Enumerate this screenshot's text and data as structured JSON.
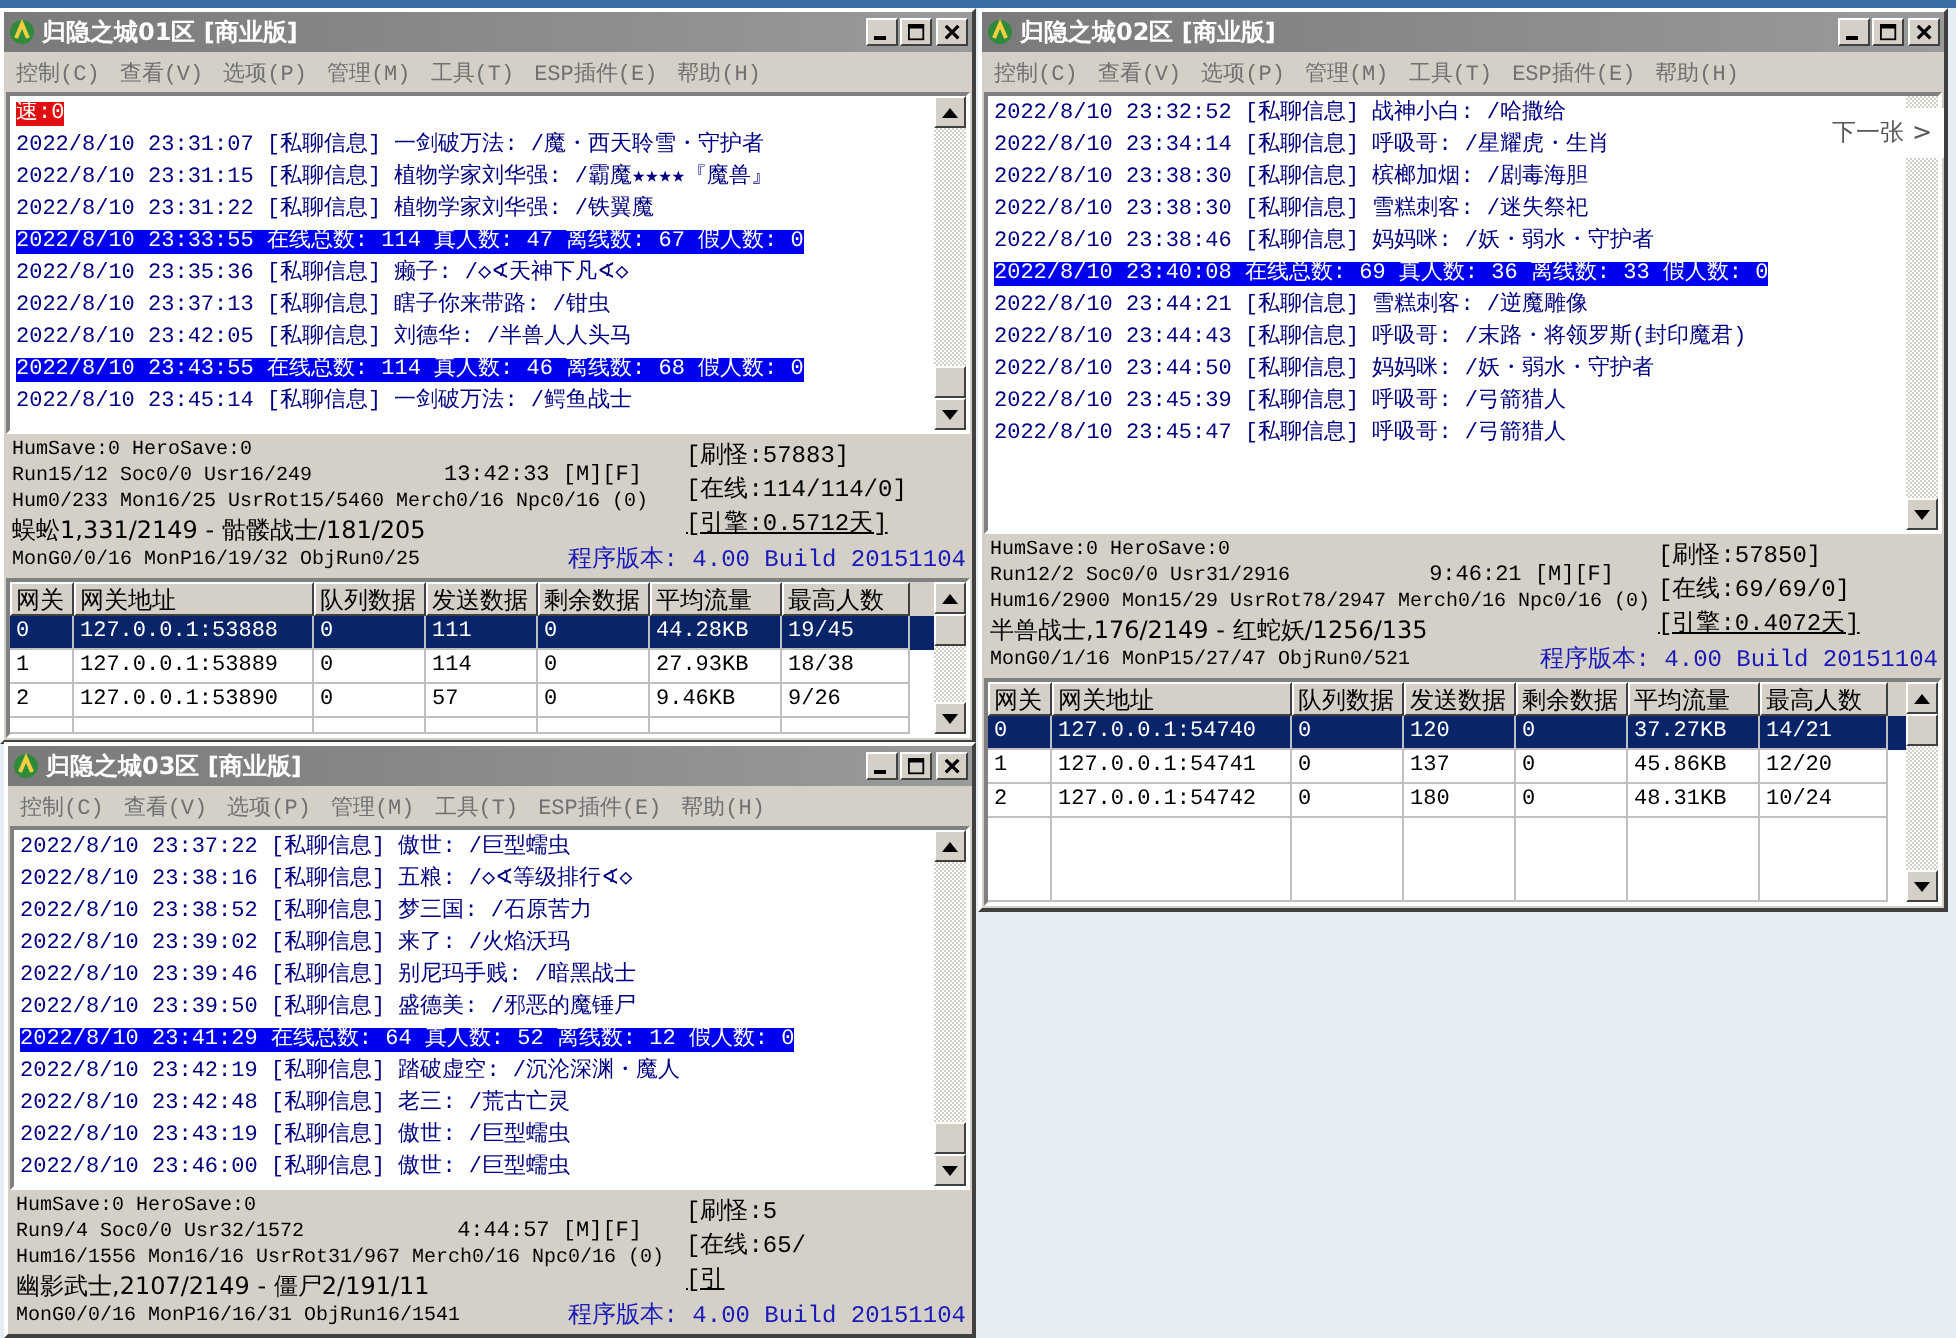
{
  "windows": [
    {
      "title": "归隐之城01区 [商业版]",
      "menu": [
        "控制(C)",
        "查看(V)",
        "选项(P)",
        "管理(M)",
        "工具(T)",
        "ESP插件(E)",
        "帮助(H)"
      ],
      "log": [
        {
          "kind": "alert",
          "text": "速:0"
        },
        {
          "kind": "chat",
          "text": "2022/8/10 23:31:07 [私聊信息] 一剑破万法: /魔・西天聆雪・守护者"
        },
        {
          "kind": "chat",
          "text": "2022/8/10 23:31:15 [私聊信息] 植物学家刘华强: /霸魔★★★★『魔兽』"
        },
        {
          "kind": "chat",
          "text": "2022/8/10 23:31:22 [私聊信息] 植物学家刘华强: /铁翼魔"
        },
        {
          "kind": "stat",
          "text": "2022/8/10 23:33:55 在线总数: 114 真人数: 47 离线数: 67 假人数: 0"
        },
        {
          "kind": "chat",
          "text": "2022/8/10 23:35:36 [私聊信息] 癞子: /◇∢天神下凡∢◇"
        },
        {
          "kind": "chat",
          "text": "2022/8/10 23:37:13 [私聊信息] 瞎子你来带路: /钳虫"
        },
        {
          "kind": "chat",
          "text": "2022/8/10 23:42:05 [私聊信息] 刘德华: /半兽人人头马"
        },
        {
          "kind": "stat",
          "text": "2022/8/10 23:43:55 在线总数: 114 真人数: 46 离线数: 68 假人数: 0"
        },
        {
          "kind": "chat",
          "text": "2022/8/10 23:45:14 [私聊信息] 一剑破万法: /鳄鱼战士"
        }
      ],
      "status": {
        "save": "HumSave:0 HeroSave:0",
        "run": "Run15/12 Soc0/0 Usr16/249",
        "time": "13:42:33 [M][F]",
        "hum": "Hum0/233 Mon16/25 UsrRot15/5460 Merch0/16 Npc0/16 (0)",
        "mon": "蜈蚣1,331/2149 - 骷髅战士/181/205",
        "mong": "MonG0/0/16 MonP16/19/32 ObjRun0/25",
        "refresh": "[刷怪:57883]",
        "online": "[在线:114/114/0]",
        "engine": "[引擎:0.5712天]",
        "version": "程序版本: 4.00 Build 20151104"
      },
      "table": {
        "columns": [
          "网关",
          "网关地址",
          "队列数据",
          "发送数据",
          "剩余数据",
          "平均流量",
          "最高人数"
        ],
        "rows": [
          {
            "cells": [
              "0",
              "127.0.0.1:53888",
              "0",
              "111",
              "0",
              "44.28KB",
              "19/45"
            ],
            "selected": true
          },
          {
            "cells": [
              "1",
              "127.0.0.1:53889",
              "0",
              "114",
              "0",
              "27.93KB",
              "18/38"
            ],
            "selected": false
          },
          {
            "cells": [
              "2",
              "127.0.0.1:53890",
              "0",
              "57",
              "0",
              "9.46KB",
              "9/26"
            ],
            "selected": false
          }
        ]
      }
    },
    {
      "title": "归隐之城02区 [商业版]",
      "menu": [
        "控制(C)",
        "查看(V)",
        "选项(P)",
        "管理(M)",
        "工具(T)",
        "ESP插件(E)",
        "帮助(H)"
      ],
      "log": [
        {
          "kind": "chat",
          "text": "2022/8/10 23:32:52 [私聊信息] 战神小白: /哈撒给"
        },
        {
          "kind": "chat",
          "text": "2022/8/10 23:34:14 [私聊信息] 呼吸哥: /星耀虎・生肖"
        },
        {
          "kind": "chat",
          "text": "2022/8/10 23:38:30 [私聊信息] 槟榔加烟: /剧毒海胆"
        },
        {
          "kind": "chat",
          "text": "2022/8/10 23:38:30 [私聊信息] 雪糕刺客: /迷失祭祀"
        },
        {
          "kind": "chat",
          "text": "2022/8/10 23:38:46 [私聊信息] 妈妈咪: /妖・弱水・守护者"
        },
        {
          "kind": "stat",
          "text": "2022/8/10 23:40:08 在线总数: 69 真人数: 36 离线数: 33 假人数: 0"
        },
        {
          "kind": "chat",
          "text": "2022/8/10 23:44:21 [私聊信息] 雪糕刺客: /逆魔雕像"
        },
        {
          "kind": "chat",
          "text": "2022/8/10 23:44:43 [私聊信息] 呼吸哥: /末路・将领罗斯(封印魔君)"
        },
        {
          "kind": "chat",
          "text": "2022/8/10 23:44:50 [私聊信息] 妈妈咪: /妖・弱水・守护者"
        },
        {
          "kind": "chat",
          "text": "2022/8/10 23:45:39 [私聊信息] 呼吸哥: /弓箭猎人"
        },
        {
          "kind": "chat",
          "text": "2022/8/10 23:45:47 [私聊信息] 呼吸哥: /弓箭猎人"
        }
      ],
      "status": {
        "save": "HumSave:0 HeroSave:0",
        "run": "Run12/2 Soc0/0 Usr31/2916",
        "time": "9:46:21 [M][F]",
        "hum": "Hum16/2900 Mon15/29 UsrRot78/2947 Merch0/16 Npc0/16 (0)",
        "mon": "半兽战士,176/2149 - 红蛇妖/1256/135",
        "mong": "MonG0/1/16 MonP15/27/47 ObjRun0/521",
        "refresh": "[刷怪:57850]",
        "online": "[在线:69/69/0]",
        "engine": "[引擎:0.4072天]",
        "version": "程序版本: 4.00 Build 20151104"
      },
      "table": {
        "columns": [
          "网关",
          "网关地址",
          "队列数据",
          "发送数据",
          "剩余数据",
          "平均流量",
          "最高人数"
        ],
        "rows": [
          {
            "cells": [
              "0",
              "127.0.0.1:54740",
              "0",
              "120",
              "0",
              "37.27KB",
              "14/21"
            ],
            "selected": true
          },
          {
            "cells": [
              "1",
              "127.0.0.1:54741",
              "0",
              "137",
              "0",
              "45.86KB",
              "12/20"
            ],
            "selected": false
          },
          {
            "cells": [
              "2",
              "127.0.0.1:54742",
              "0",
              "180",
              "0",
              "48.31KB",
              "10/24"
            ],
            "selected": false
          }
        ]
      }
    },
    {
      "title": "归隐之城03区 [商业版]",
      "menu": [
        "控制(C)",
        "查看(V)",
        "选项(P)",
        "管理(M)",
        "工具(T)",
        "ESP插件(E)",
        "帮助(H)"
      ],
      "log": [
        {
          "kind": "chat",
          "text": "2022/8/10 23:37:22 [私聊信息] 傲世: /巨型蠕虫"
        },
        {
          "kind": "chat",
          "text": "2022/8/10 23:38:16 [私聊信息] 五粮: /◇∢等级排行∢◇"
        },
        {
          "kind": "chat",
          "text": "2022/8/10 23:38:52 [私聊信息] 梦三国: /石原苦力"
        },
        {
          "kind": "chat",
          "text": "2022/8/10 23:39:02 [私聊信息] 来了: /火焰沃玛"
        },
        {
          "kind": "chat",
          "text": "2022/8/10 23:39:46 [私聊信息] 别尼玛手贱: /暗黑战士"
        },
        {
          "kind": "chat",
          "text": "2022/8/10 23:39:50 [私聊信息] 盛德美: /邪恶的魔锤尸"
        },
        {
          "kind": "stat",
          "text": "2022/8/10 23:41:29 在线总数: 64 真人数: 52 离线数: 12 假人数: 0"
        },
        {
          "kind": "chat",
          "text": "2022/8/10 23:42:19 [私聊信息] 踏破虚空: /沉沦深渊・魔人"
        },
        {
          "kind": "chat",
          "text": "2022/8/10 23:42:48 [私聊信息] 老三: /荒古亡灵"
        },
        {
          "kind": "chat",
          "text": "2022/8/10 23:43:19 [私聊信息] 傲世: /巨型蠕虫"
        },
        {
          "kind": "chat",
          "text": "2022/8/10 23:46:00 [私聊信息] 傲世: /巨型蠕虫"
        }
      ],
      "status": {
        "save": "HumSave:0 HeroSave:0",
        "run": "Run9/4 Soc0/0 Usr32/1572",
        "time": "4:44:57 [M][F]",
        "hum": "Hum16/1556 Mon16/16 UsrRot31/967 Merch0/16 Npc0/16 (0)",
        "mon": "幽影武士,2107/2149 - 僵尸2/191/11",
        "mong": "MonG0/0/16 MonP16/16/31 ObjRun16/1541",
        "refresh": "[刷怪:5",
        "online": "[在线:65/",
        "engine": "[引",
        "version": "程序版本: 4.00 Build 20151104"
      }
    }
  ],
  "next_button": "下一张 >"
}
